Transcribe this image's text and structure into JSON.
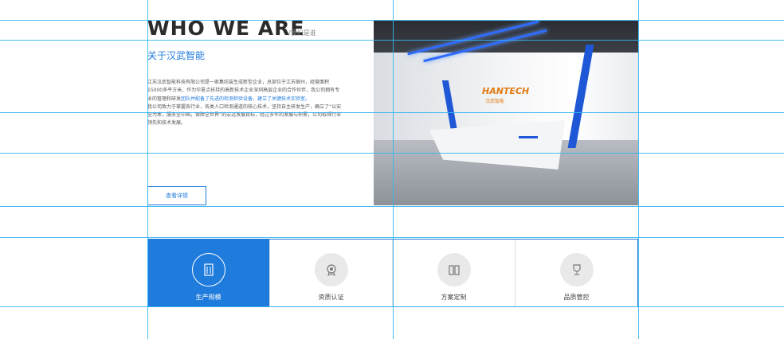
{
  "about": {
    "title_en": "WHO WE ARE",
    "subtitle": "/我们是谁",
    "title_cn": "关于汉武智能",
    "intro_p1": "江苏汉武智能科技有限公司是一家集纺装生成新型企业，总部位于江苏宿州，经营面积15000多平方米，作为华夏点扶持的高新技术企业深圳高层企业的合作伙伴，我公司拥有专业的管理和研发",
    "intro_hl": "团队并配备了先进的检测检验设备，建立了关键技术实验室。",
    "intro_p2": "我公司致力于掌握各行业，各类人口检测通道的核心技术，坚持自主研发生产，确立了“以安全为本，服务全中国，保障全世界”的宏远发展目标，经过多年的发展与积累，公司取得行业领先和技术发展。",
    "more_label": "查看详情"
  },
  "photo": {
    "logo": "HANTECH",
    "logo_cn": "汉武智能"
  },
  "features": [
    {
      "label": "生产规模",
      "icon": "building-icon",
      "active": true
    },
    {
      "label": "资质认证",
      "icon": "badge-gear-icon",
      "active": false
    },
    {
      "label": "方案定制",
      "icon": "cabinet-icon",
      "active": false
    },
    {
      "label": "品质管控",
      "icon": "trophy-icon",
      "active": false
    }
  ],
  "colors": {
    "accent": "#1f7bdc",
    "guide": "#33b6f2"
  }
}
